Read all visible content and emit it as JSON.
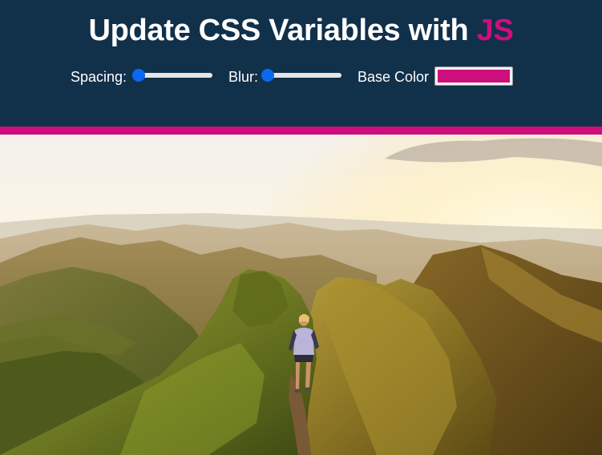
{
  "header": {
    "title_main": "Update CSS Variables with ",
    "title_highlight": "JS"
  },
  "controls": {
    "spacing_label": "Spacing:",
    "spacing_value": 0,
    "blur_label": "Blur:",
    "blur_value": 0,
    "base_color_label": "Base Color",
    "base_color_value": "#ce0e7d"
  },
  "colors": {
    "header_bg": "#11304a",
    "accent": "#ce0e7d",
    "slider_thumb": "#0b68f0"
  },
  "image": {
    "alt": "hiker on mountain ridge at sunrise"
  }
}
